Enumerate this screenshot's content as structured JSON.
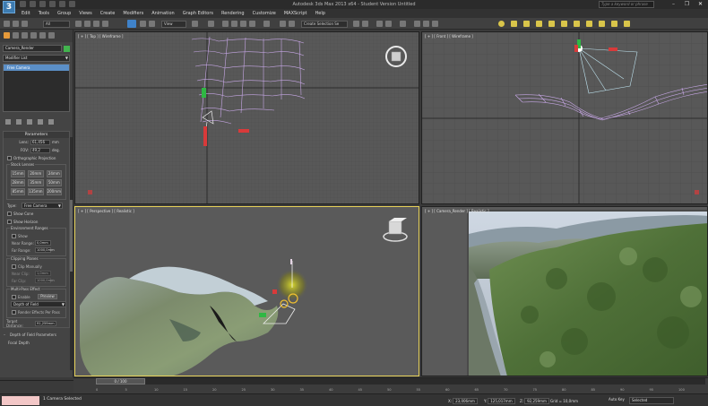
{
  "app": {
    "title": "Autodesk 3ds Max 2013 x64 - Student Version   Untitled",
    "logo": "3",
    "search_placeholder": "Type a keyword or phrase",
    "window_controls": [
      "–",
      "❐",
      "✕"
    ]
  },
  "menu": [
    "Edit",
    "Tools",
    "Group",
    "Views",
    "Create",
    "Modifiers",
    "Animation",
    "Graph Editors",
    "Rendering",
    "Customize",
    "MAXScript",
    "Help"
  ],
  "toolbar": {
    "selection_filter": "All",
    "ref_coord": "View",
    "named_selection": "Create Selection Se"
  },
  "command_panel": {
    "object_name": "Camera_Render",
    "object_color": "#42b44e",
    "modifier_list": "Modifier List",
    "stack_item": "Free Camera",
    "parameters": {
      "title": "Parameters",
      "lens_label": "Lens:",
      "lens_value": "61,456",
      "lens_unit": "mm",
      "fov_label": "FOV:",
      "fov_value": "49,2",
      "fov_unit": "deg.",
      "orthographic": "Orthographic Projection",
      "stock_lenses_title": "Stock Lenses",
      "stock_lenses": [
        "15mm",
        "20mm",
        "24mm",
        "28mm",
        "35mm",
        "50mm",
        "85mm",
        "135mm",
        "200mm"
      ],
      "type_label": "Type:",
      "type_value": "Free Camera",
      "show_cone": "Show Cone",
      "show_horizon": "Show Horizon",
      "env_ranges_title": "Environment Ranges",
      "env_show": "Show",
      "near_range_label": "Near Range:",
      "near_range_value": "0,0mm",
      "far_range_label": "Far Range:",
      "far_range_value": "1000,0mm",
      "clipping_title": "Clipping Planes",
      "clip_manually": "Clip Manually",
      "near_clip_label": "Near Clip:",
      "near_clip_value": "1,0mm",
      "far_clip_label": "Far Clip:",
      "far_clip_value": "1000,0mm",
      "multipass_title": "Multi-Pass Effect",
      "enable": "Enable",
      "preview": "Preview",
      "effect_value": "Depth of Field",
      "render_per_pass": "Render Effects Per Pass",
      "target_distance_label": "Target Distance:",
      "target_distance_value": "91,259mm"
    },
    "dof_title": "Depth of Field Parameters",
    "focal_depth": "Focal Depth"
  },
  "viewports": {
    "top": "[ + ] [ Top ] [ Wireframe ]",
    "front": "[ + ] [ Front ] [ Wireframe ]",
    "perspective": "[ + ] [ Perspective ] [ Realistic ]",
    "camera": "[ + ] [ Camera_Render ] [ Realistic ]"
  },
  "timeline": {
    "slider_label": "0 / 100",
    "ticks": [
      "0",
      "5",
      "10",
      "15",
      "20",
      "25",
      "30",
      "35",
      "40",
      "45",
      "50",
      "55",
      "60",
      "65",
      "70",
      "75",
      "80",
      "85",
      "90",
      "95",
      "100"
    ]
  },
  "status": {
    "selection": "1 Camera Selected",
    "x_label": "X:",
    "x_value": "23,006mm",
    "y_label": "Y:",
    "y_value": "125,017mm",
    "z_label": "Z:",
    "z_value": "92,259mm",
    "grid": "Grid = 10,0mm",
    "autokey": "Auto Key",
    "selected": "Selected"
  }
}
